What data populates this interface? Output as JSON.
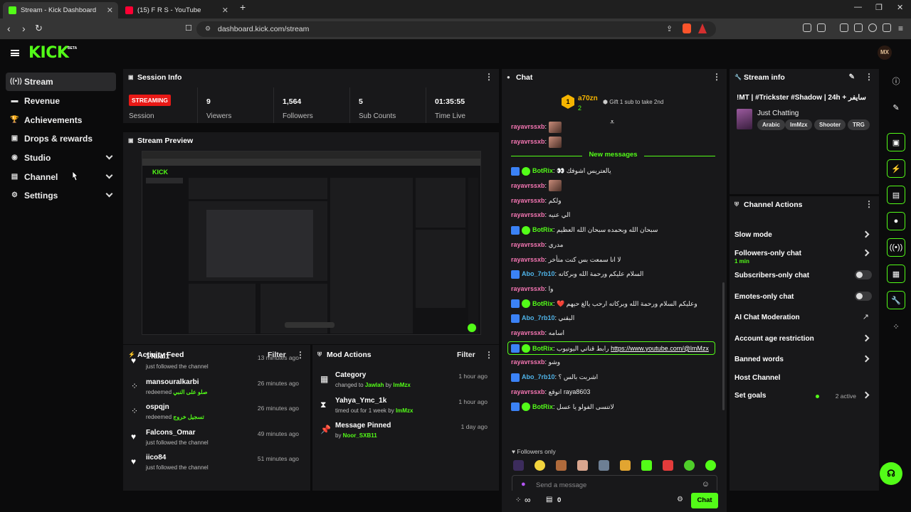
{
  "browser": {
    "tabs": [
      {
        "label": "Stream - Kick Dashboard"
      },
      {
        "label": "(15) F R S - YouTube"
      }
    ],
    "url": "dashboard.kick.com/stream"
  },
  "brand": {
    "logo": "KICK",
    "beta": "BETA",
    "avatar": "MX",
    "accent": "#53fc18"
  },
  "sidebar": {
    "items": [
      {
        "label": "Stream",
        "icon": "broadcast-icon"
      },
      {
        "label": "Revenue",
        "icon": "money-icon"
      },
      {
        "label": "Achievements",
        "icon": "trophy-icon"
      },
      {
        "label": "Drops & rewards",
        "icon": "gift-icon"
      },
      {
        "label": "Studio",
        "icon": "studio-icon"
      },
      {
        "label": "Channel",
        "icon": "channel-icon"
      },
      {
        "label": "Settings",
        "icon": "gear-icon"
      }
    ]
  },
  "session": {
    "title": "Session Info",
    "status": "STREAMING",
    "session_label": "Session",
    "stats": [
      {
        "value": "9",
        "label": "Viewers"
      },
      {
        "value": "1,564",
        "label": "Followers"
      },
      {
        "value": "5",
        "label": "Sub Counts"
      },
      {
        "value": "01:35:55",
        "label": "Time Live"
      }
    ]
  },
  "preview": {
    "title": "Stream Preview"
  },
  "activity": {
    "title": "Activity Feed",
    "filter": "Filter",
    "items": [
      {
        "name": "1Talal1",
        "sub": "just followed the channel",
        "highlight": "",
        "time": "13 minutes ago",
        "icon": "heart-icon"
      },
      {
        "name": "mansouralkarbi",
        "sub": "redeemed",
        "highlight": "صلو على النبي",
        "time": "26 minutes ago",
        "icon": "reward-icon"
      },
      {
        "name": "ospqjn",
        "sub": "redeemed",
        "highlight": "تسجيل خروج",
        "time": "26 minutes ago",
        "icon": "reward-icon"
      },
      {
        "name": "Falcons_Omar",
        "sub": "just followed the channel",
        "highlight": "",
        "time": "49 minutes ago",
        "icon": "heart-icon"
      },
      {
        "name": "iico84",
        "sub": "just followed the channel",
        "highlight": "",
        "time": "51 minutes ago",
        "icon": "heart-icon"
      }
    ]
  },
  "mod": {
    "title": "Mod Actions",
    "filter": "Filter",
    "items": [
      {
        "title": "Category",
        "pre": "changed to ",
        "target": "Jawlah",
        "mid": " by ",
        "by": "ImMzx",
        "time": "1 hour ago",
        "icon": "category-icon"
      },
      {
        "title": "Yahya_Ymc_1k",
        "pre": "timed out for 1 week by ",
        "target": "",
        "mid": "",
        "by": "ImMzx",
        "time": "1 hour ago",
        "icon": "hourglass-icon"
      },
      {
        "title": "Message Pinned",
        "pre": "by ",
        "target": "",
        "mid": "",
        "by": "Noor_SXB11",
        "time": "1 day ago",
        "icon": "pin-icon"
      }
    ]
  },
  "chat": {
    "title": "Chat",
    "top_user": "a70zn",
    "top_rank": "1",
    "top_count": "2",
    "gift_text": "Gift 1 sub to take 2nd",
    "new_messages": "New messages",
    "messages": [
      {
        "user": "rayavrssxb",
        "text": "",
        "color": "#f576b3",
        "badge": "",
        "emote": true
      },
      {
        "user": "rayavrssxb",
        "text": "",
        "color": "#f576b3",
        "badge": "",
        "emote": true
      },
      {
        "user": "BotRix",
        "text": "يالعتريس اشوفك 👀",
        "color": "#53fc18",
        "badge": "bot",
        "emote": false
      },
      {
        "user": "rayavrssxb",
        "text": "",
        "color": "#f576b3",
        "badge": "",
        "emote": true
      },
      {
        "user": "rayavrssxb",
        "text": "ولكم",
        "color": "#f576b3",
        "badge": "",
        "emote": false
      },
      {
        "user": "rayavrssxb",
        "text": "الي عنيه",
        "color": "#f576b3",
        "badge": "",
        "emote": false
      },
      {
        "user": "BotRix",
        "text": "سبحان الله وبحمده سبحان الله العظيم",
        "color": "#53fc18",
        "badge": "bot",
        "emote": false
      },
      {
        "user": "rayavrssxb",
        "text": "مدري",
        "color": "#f576b3",
        "badge": "",
        "emote": false
      },
      {
        "user": "rayavrssxb",
        "text": "لا انا سمعت بس كنت متأخر",
        "color": "#f576b3",
        "badge": "",
        "emote": false
      },
      {
        "user": "Abo_7rb10",
        "text": "السلام عليكم ورحمة الله وبركاته",
        "color": "#4fb3e8",
        "badge": "blue",
        "emote": false
      },
      {
        "user": "rayavrssxb",
        "text": "وا",
        "color": "#f576b3",
        "badge": "",
        "emote": false
      },
      {
        "user": "BotRix",
        "text": "وعليكم السلام ورحمة الله وبركاته ارحب يالغ حيهم ❤️",
        "color": "#53fc18",
        "badge": "bot",
        "emote": false
      },
      {
        "user": "Abo_7rb10",
        "text": "البقني",
        "color": "#4fb3e8",
        "badge": "blue",
        "emote": false
      },
      {
        "user": "rayavrssxb",
        "text": "اسامه",
        "color": "#f576b3",
        "badge": "",
        "emote": false
      },
      {
        "user": "BotRix",
        "text": "رابط قناتي اليوتيوب",
        "link": "https://www.youtube.com/@lmMzx",
        "color": "#53fc18",
        "badge": "bot",
        "emote": false,
        "highlight": true
      },
      {
        "user": "rayavrssxb",
        "text": "وشو",
        "color": "#f576b3",
        "badge": "",
        "emote": false
      },
      {
        "user": "Abo_7rb10",
        "text": "اشربت بالس ؟",
        "color": "#4fb3e8",
        "badge": "blue",
        "emote": false
      },
      {
        "user": "rayavrssxb",
        "text": "raya8603 اتوقع",
        "color": "#f576b3",
        "badge": "",
        "emote": false
      },
      {
        "user": "BotRix",
        "text": "لاتنسى الفولو يا عسل",
        "color": "#53fc18",
        "badge": "bot",
        "emote": false
      }
    ],
    "followers_only": "Followers only",
    "placeholder": "Send a message",
    "send": "Chat",
    "points": "0",
    "infinity": "∞"
  },
  "stream_info": {
    "title": "Stream info",
    "stream_title": "!MT | #Trickster #Shadow | 24h + سايفر",
    "category": "Just Chatting",
    "tags": [
      "Arabic",
      "ImMzx",
      "Shooter",
      "TRG"
    ]
  },
  "channel_actions": {
    "title": "Channel Actions",
    "rows": [
      {
        "label": "Slow mode",
        "sub": "",
        "ctrl": "chevron"
      },
      {
        "label": "Followers-only chat",
        "sub": "1 min",
        "ctrl": "chevron"
      },
      {
        "label": "Subscribers-only chat",
        "sub": "",
        "ctrl": "toggle"
      },
      {
        "label": "Emotes-only chat",
        "sub": "",
        "ctrl": "toggle"
      },
      {
        "label": "AI Chat Moderation",
        "sub": "",
        "ctrl": "external"
      },
      {
        "label": "Account age restriction",
        "sub": "",
        "ctrl": "chevron"
      },
      {
        "label": "Banned words",
        "sub": "",
        "ctrl": "chevron"
      },
      {
        "label": "Host Channel",
        "sub": "",
        "ctrl": "none"
      },
      {
        "label": "Set goals",
        "sub": "",
        "ctrl": "chevron",
        "status": "2 active"
      }
    ]
  }
}
